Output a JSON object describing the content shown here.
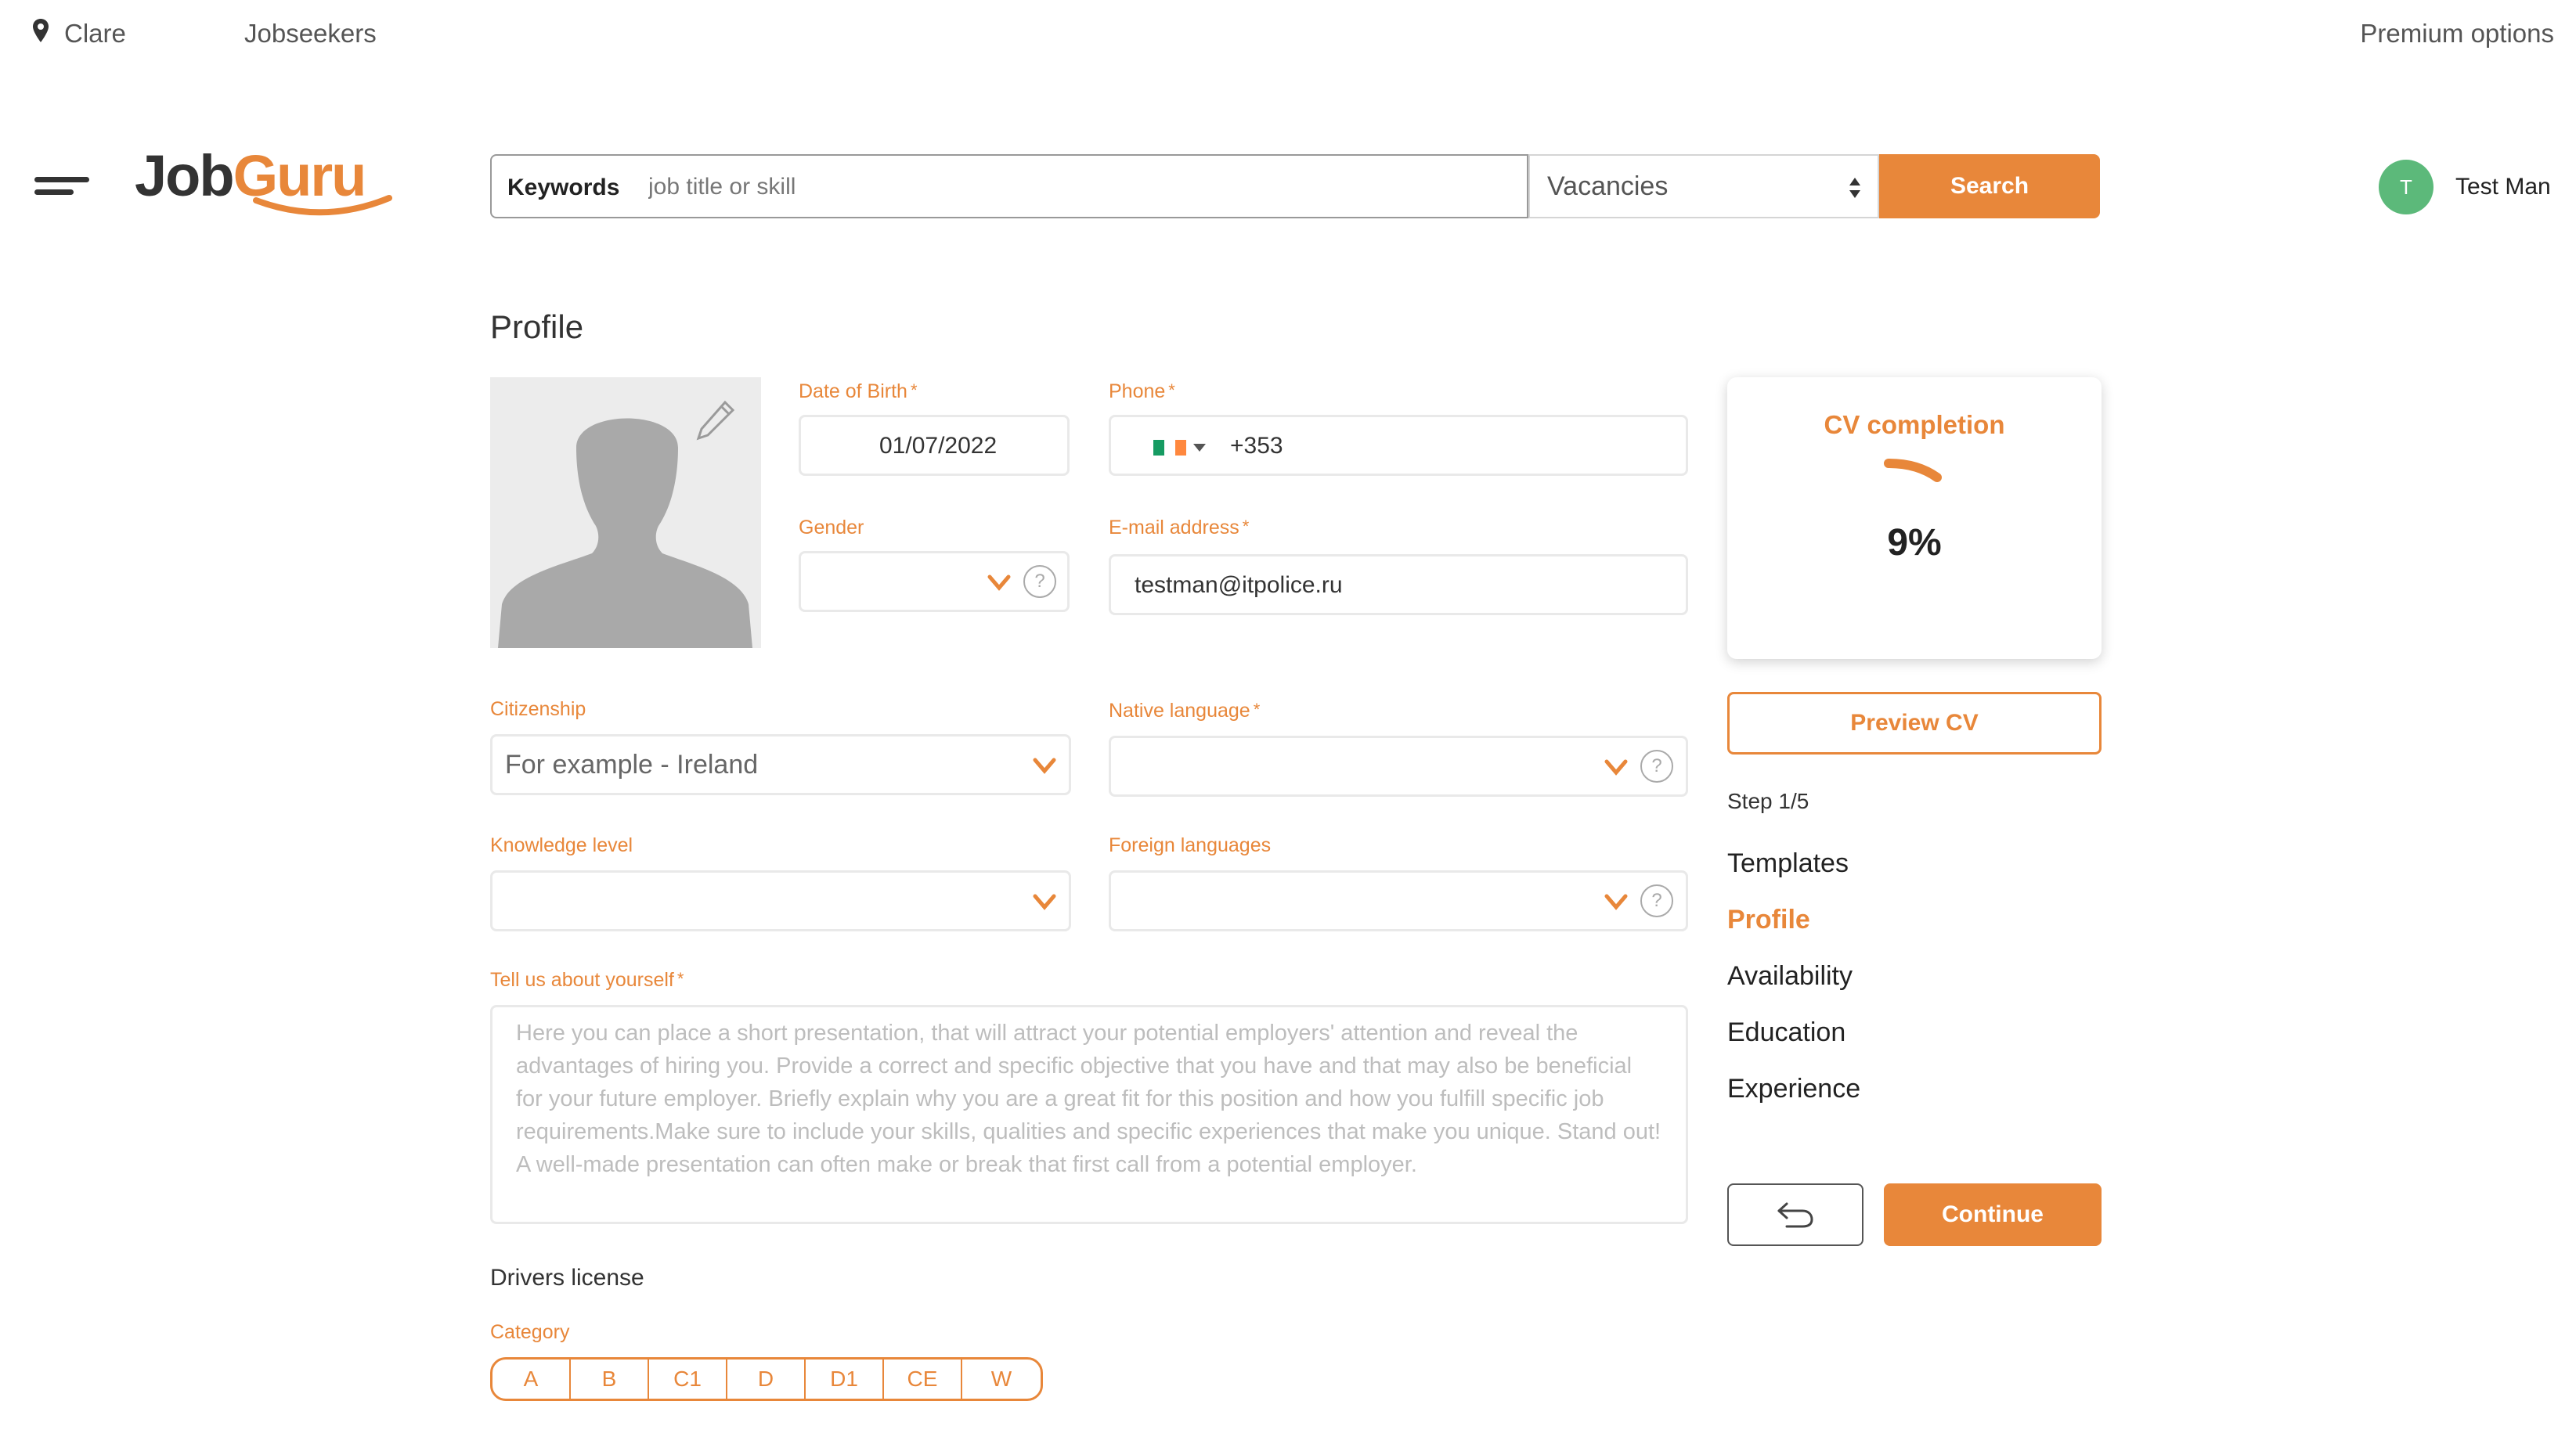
{
  "topbar": {
    "location": "Clare",
    "jobseekers": "Jobseekers",
    "premium": "Premium options"
  },
  "header": {
    "logo_part1": "Job",
    "logo_part2": "Guru",
    "search_label": "Keywords",
    "search_placeholder": "job title or skill",
    "search_type": "Vacancies",
    "search_button": "Search",
    "user_initial": "T",
    "user_name": "Test Man"
  },
  "profile": {
    "title": "Profile",
    "dob_label": "Date of Birth",
    "dob_value": "01/07/2022",
    "phone_label": "Phone",
    "phone_code": "+353",
    "gender_label": "Gender",
    "email_label": "E-mail address",
    "email_value": "testman@itpolice.ru",
    "citizenship_label": "Citizenship",
    "citizenship_placeholder": "For example - Ireland",
    "native_label": "Native language",
    "knowledge_label": "Knowledge level",
    "foreign_label": "Foreign languages",
    "about_label": "Tell us about yourself",
    "about_placeholder": "Here you can place a short presentation, that will attract your potential employers' attention and reveal the advantages of hiring you. Provide a correct and specific objective that you have and that may also be beneficial for your future employer.  Briefly explain why you are a great fit for this position and how you fulfill specific job requirements.Make sure to include your skills, qualities and specific experiences that make you unique. Stand out! A well-made presentation can often make or break that first call from a potential employer.",
    "drivers_label": "Drivers license",
    "category_label": "Category",
    "categories": [
      "A",
      "B",
      "C1",
      "D",
      "D1",
      "CE",
      "W"
    ]
  },
  "sidebar": {
    "cv_title": "CV completion",
    "cv_percent": "9%",
    "cv_progress": 0.09,
    "preview_button": "Preview CV",
    "step": "Step 1/5",
    "nav": [
      "Templates",
      "Profile",
      "Availability",
      "Education",
      "Experience"
    ],
    "active_nav": "Profile",
    "continue_button": "Continue"
  },
  "colors": {
    "accent": "#E8873A",
    "avatar": "#5CB97A"
  }
}
